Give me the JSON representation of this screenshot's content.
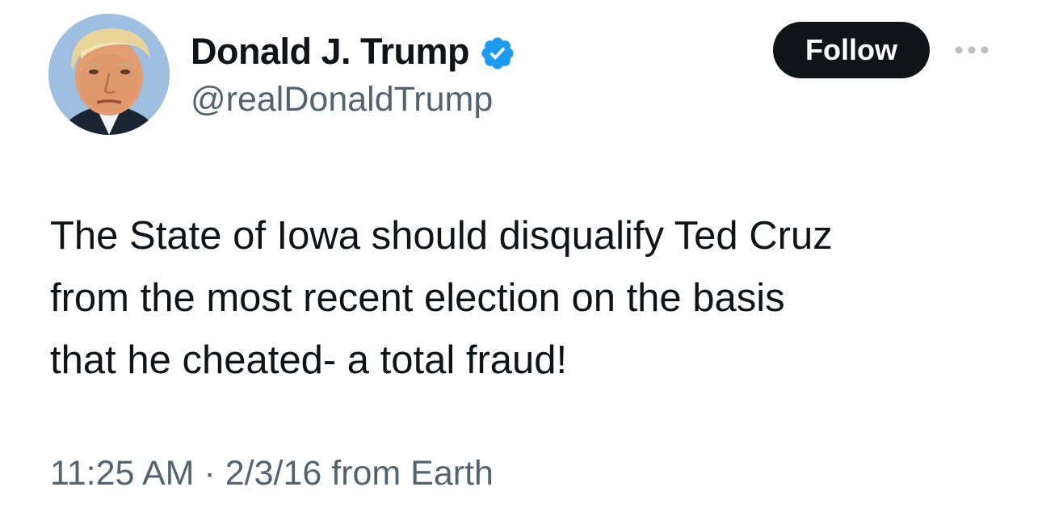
{
  "user": {
    "display_name": "Donald J. Trump",
    "handle": "@realDonaldTrump",
    "verified": true,
    "verified_icon": "verified-badge-icon",
    "avatar_icon": "profile-photo"
  },
  "actions": {
    "follow_label": "Follow",
    "more_icon": "more-options-icon"
  },
  "tweet": {
    "text": "The State of Iowa should disqualify Ted Cruz\nfrom the most recent election on the basis\nthat he cheated- a total fraud!",
    "time": "11:25 AM",
    "separator": "·",
    "date_source": "2/3/16 from Earth"
  },
  "colors": {
    "primary_text": "#0f1419",
    "secondary_text": "#536471",
    "verified_blue": "#1d9bf0",
    "follow_button_bg": "#0f1419",
    "follow_button_text": "#ffffff",
    "background": "#ffffff"
  }
}
